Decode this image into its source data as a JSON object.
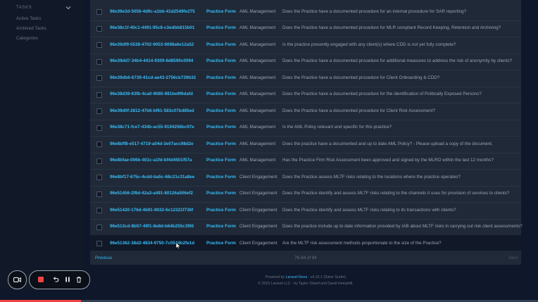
{
  "sidebar": {
    "heading": "TASKS",
    "items": [
      {
        "label": "Active Tasks"
      },
      {
        "label": "Archived Tasks"
      },
      {
        "label": "Categories"
      }
    ]
  },
  "table": {
    "rows": [
      {
        "id": "96e39e3d-5056-4d9c-a1bb-41d2549fe275",
        "type": "Practice Form",
        "category": "AML Management",
        "question": "Does the Practice have a documented procedure for an internal procedure for SAR reporting?"
      },
      {
        "id": "96e38c1f-40c1-4491-95c8-c3edbb815b01",
        "type": "Practice Form",
        "category": "AML Management",
        "question": "Does the Practice have a documented procedure for MLR compliant Record Keeping, Retention and Archiving?"
      },
      {
        "id": "96e39df9-5538-4702-9053-9098a6e12a52",
        "type": "Practice Form",
        "category": "AML Management",
        "question": "Is the practice presently engaged with any client(s) where CDD is not yet fully complete?"
      },
      {
        "id": "96e39dd7-34b4-4414-9309-8d8590c0094",
        "type": "Practice Form",
        "category": "AML Management",
        "question": "Does the Practice have a documented procedure for additional measures to address the risk of anonymity by clients?"
      },
      {
        "id": "96e39db6-6739-41cd-ae43-2756cb739b32",
        "type": "Practice Form",
        "category": "AML Management",
        "question": "Does the Practice have a documented procedure for Client Onboarding & CDD?"
      },
      {
        "id": "96e38d39-63fb-4ca0-9085-981be9f6dafd",
        "type": "Practice Form",
        "category": "AML Management",
        "question": "Does the Practice have a documented procedure for the identification of Politically Exposed Persons?"
      },
      {
        "id": "96e39d0f-2812-47b6-bf61-583c07bd85ed",
        "type": "Practice Form",
        "category": "AML Management",
        "question": "Does the Practice have a documented procedure for Client Risk Assessment?"
      },
      {
        "id": "96e38c71-fce7-434b-ac55-9194256bc97e",
        "type": "Practice Form",
        "category": "AML Management",
        "question": "Is the AML Policy relevant and specific for this practice?"
      },
      {
        "id": "96e8bff8-e517-4719-a04d-3e07acc98d2e",
        "type": "Practice Form",
        "category": "AML Management",
        "question": "Does the practice have a documented and up to date AML Policy? - Please upload a copy of the document."
      },
      {
        "id": "96e8bfae-006b-401c-a1fd-bf4d4501f57a",
        "type": "Practice Form",
        "category": "AML Management",
        "question": "Has the Practice Firm Risk Assessment been approved and signed by the MLRO within the last 12 months?"
      },
      {
        "id": "96e8bf17-675c-4cdd-ba5c-68c21c31a8ee",
        "type": "Practice Form",
        "category": "Client Engagement",
        "question": "Does the Practice assess MLTF risks relating to the locations where the practice operates?"
      },
      {
        "id": "96e51456-2f8d-42a3-a491-80126a506ef2",
        "type": "Practice Form",
        "category": "Client Engagement",
        "question": "Does the Practice identify and assess MLTF risks relating to the channels it uses for provision of services to clients?"
      },
      {
        "id": "96e51420-176d-4b91-9032-6c12321f736f",
        "type": "Practice Form",
        "category": "Client Engagement",
        "question": "Does the Practice identify and assess MLTF risks relating to its transactions with clients?"
      },
      {
        "id": "96e513cd-8b57-49f1-8e8d-b64b255c3f65",
        "type": "Practice Form",
        "category": "Client Engagement",
        "question": "Does the practice include up to date information provided by IAB about MLTF risks in carrying out risk client assessments?"
      },
      {
        "id": "96e51362-38d2-4834-9750-7c0544b2fe1d",
        "type": "Practice Form",
        "category": "Client Engagement",
        "question": "Are the MLTF risk assessment methods proportionate to the size of the Practice?"
      }
    ]
  },
  "pagination": {
    "previous": "Previous",
    "range": "76-94 of 94",
    "next": "Next"
  },
  "footer": {
    "powered_by": "Powered by",
    "brand": "Laravel Nova",
    "version": "· v4.15.1 (Silver Surfer)",
    "copyright": "© 2023 Laravel LLC · by Taylor Otwell and David Hemphill."
  },
  "recorder": {
    "progress_fraction": 0.15,
    "progress_color": "#ef4444"
  },
  "colors": {
    "link": "#38bdf8",
    "panel": "#1f2937",
    "background": "#0f172a"
  }
}
